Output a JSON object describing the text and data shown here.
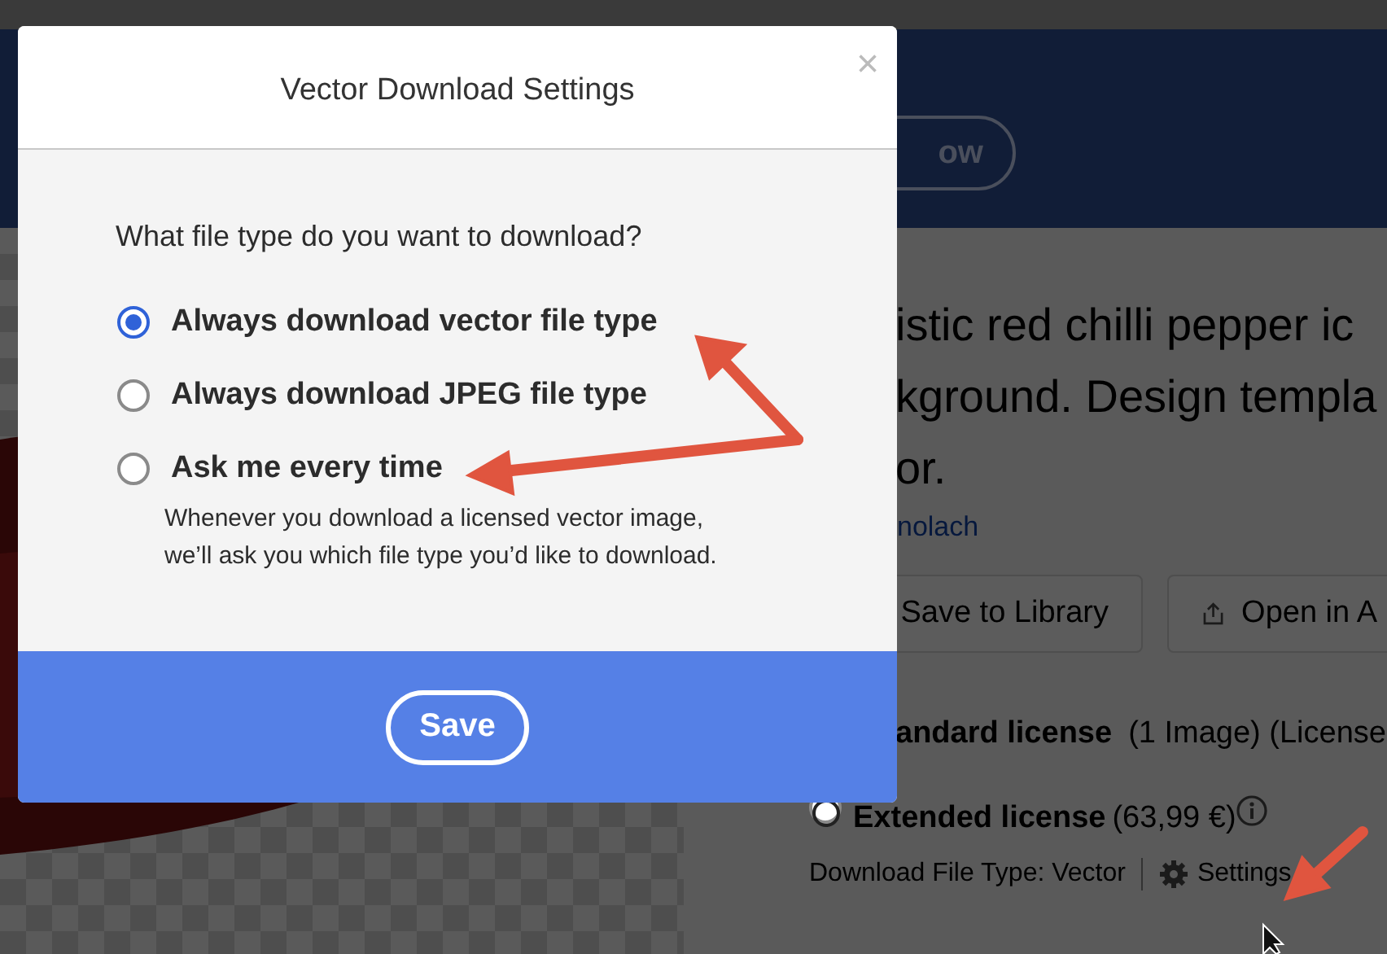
{
  "background_page": {
    "header": {
      "button": "ow"
    },
    "title_lines": [
      "istic red chilli pepper ic",
      "kground. Design templa",
      "or."
    ],
    "author_link": "nolach",
    "actions": [
      {
        "label": "Save to Library",
        "kind": "plain"
      },
      {
        "label": "Open in A",
        "kind": "share"
      }
    ],
    "licenses": [
      {
        "name": "andard license",
        "detail": "(1 Image) (License",
        "kind": "covered",
        "info": false
      },
      {
        "name": "Extended license",
        "detail": "(63,99 €)",
        "kind": "radio",
        "selected": false,
        "info": true
      }
    ],
    "file_type": {
      "label": "Download File Type: Vector",
      "settings": "Settings"
    }
  },
  "dialog": {
    "title": "Vector Download Settings",
    "close": "×",
    "question": "What file type do you want to download?",
    "options": [
      {
        "label": "Always download vector file type",
        "selected": true
      },
      {
        "label": "Always download JPEG file type",
        "selected": false
      },
      {
        "label": "Ask me every time",
        "selected": false,
        "description": "Whenever you download a licensed vector image, we’ll ask you which file type you’d like to download."
      }
    ],
    "save": "Save"
  }
}
